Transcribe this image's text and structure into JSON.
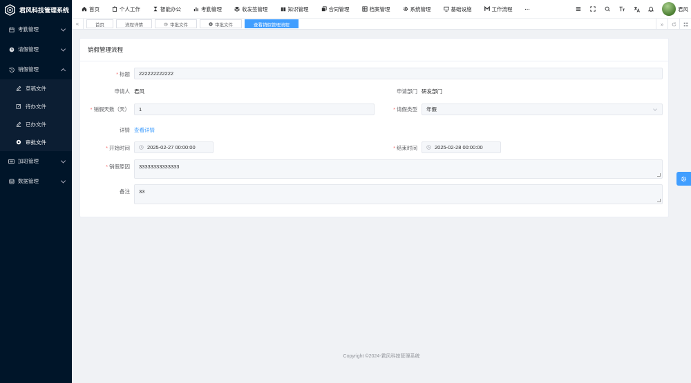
{
  "app": {
    "title": "君风科技管理系统"
  },
  "sidebar": {
    "items": [
      {
        "label": "考勤管理",
        "icon": "calendar-icon"
      },
      {
        "label": "请假管理",
        "icon": "clock-icon"
      },
      {
        "label": "销假管理",
        "icon": "history-icon"
      },
      {
        "label": "加班管理",
        "icon": "keyboard-icon"
      },
      {
        "label": "数据管理",
        "icon": "database-icon"
      }
    ],
    "submenu": [
      {
        "label": "草稿文件",
        "icon": "edit-icon"
      },
      {
        "label": "待办文件",
        "icon": "edit-outline-icon"
      },
      {
        "label": "已办文件",
        "icon": "edit-icon"
      },
      {
        "label": "审批文件",
        "icon": "circle-icon"
      }
    ]
  },
  "nav": [
    {
      "label": "首页",
      "icon": "home-icon"
    },
    {
      "label": "个人工作",
      "icon": "trash-icon"
    },
    {
      "label": "智能办公",
      "icon": "hourglass-icon"
    },
    {
      "label": "考勤管理",
      "icon": "bar-chart-icon"
    },
    {
      "label": "收发签管理",
      "icon": "layers-icon"
    },
    {
      "label": "知识管理",
      "icon": "book-icon"
    },
    {
      "label": "合同管理",
      "icon": "copy-icon"
    },
    {
      "label": "档案管理",
      "icon": "grid-icon"
    },
    {
      "label": "系统管理",
      "icon": "gear-icon"
    },
    {
      "label": "基础设施",
      "icon": "monitor-icon"
    },
    {
      "label": "工作流程",
      "icon": "workflow-icon"
    }
  ],
  "header": {
    "more": "···",
    "user_name": "君风"
  },
  "tabs": [
    {
      "label": "首页"
    },
    {
      "label": "流程详情"
    },
    {
      "label": "审批文件"
    },
    {
      "label": "审批文件"
    },
    {
      "label": "查看销假管理流程"
    }
  ],
  "form": {
    "card_title": "销假管理流程",
    "title_label": "标题",
    "title_value": "222222222222",
    "applicant_label": "申请人",
    "applicant_value": "君风",
    "dept_label": "申请部门",
    "dept_value": "研发部门",
    "days_label": "销假天数（天）",
    "days_value": "1",
    "type_label": "请假类型",
    "type_value": "年假",
    "detail_label": "详情",
    "detail_link": "查看详情",
    "start_label": "开始时间",
    "start_value": "2025-02-27 00:00:00",
    "end_label": "结束时间",
    "end_value": "2025-02-28 00:00:00",
    "reason_label": "销假原因",
    "reason_value": "33333333333333",
    "remark_label": "备注",
    "remark_value": "33"
  },
  "footer": {
    "copyright": "Copyright ©2024-君风科技管理系统"
  },
  "colors": {
    "sidebar_bg": "#001529",
    "accent": "#409eff",
    "required": "#f56c6c"
  }
}
